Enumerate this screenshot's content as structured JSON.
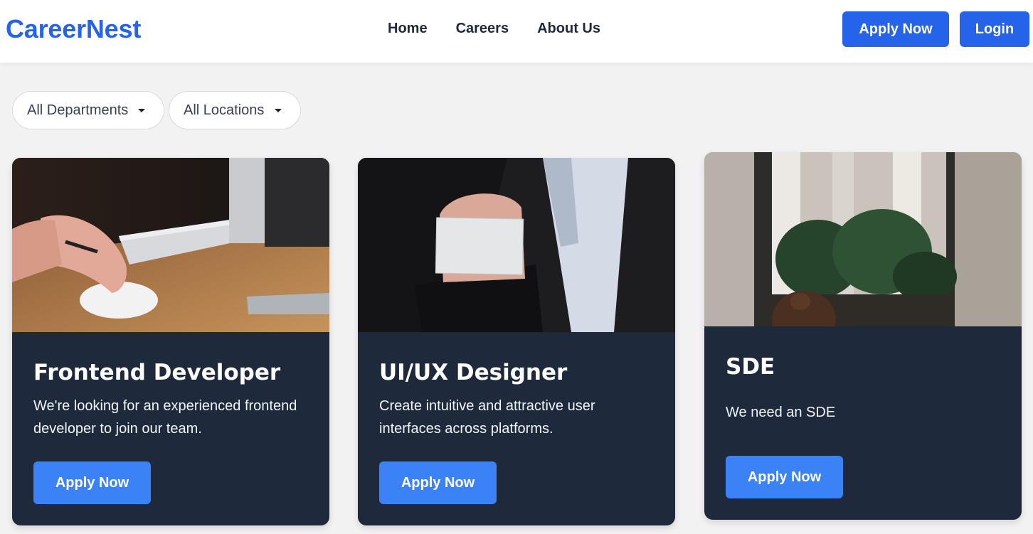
{
  "header": {
    "logo": "CareerNest",
    "nav": [
      "Home",
      "Careers",
      "About Us"
    ],
    "apply_label": "Apply Now",
    "login_label": "Login"
  },
  "filters": {
    "department": "All Departments",
    "location": "All Locations"
  },
  "jobs": [
    {
      "title": "Frontend Developer",
      "description": "We're looking for an experienced frontend developer to join our team.",
      "button": "Apply Now",
      "image": "desk-computer-mouse-photo"
    },
    {
      "title": "UI/UX Designer",
      "description": "Create intuitive and attractive user interfaces across platforms.",
      "button": "Apply Now",
      "image": "business-card-photo"
    },
    {
      "title": "SDE",
      "description": "We need an SDE",
      "button": "Apply Now",
      "image": "office-plants-photo"
    }
  ],
  "colors": {
    "brand": "#2563eb",
    "card_bg": "#1e293b",
    "card_button": "#3b82f6",
    "page_bg": "#f3f2f3"
  }
}
